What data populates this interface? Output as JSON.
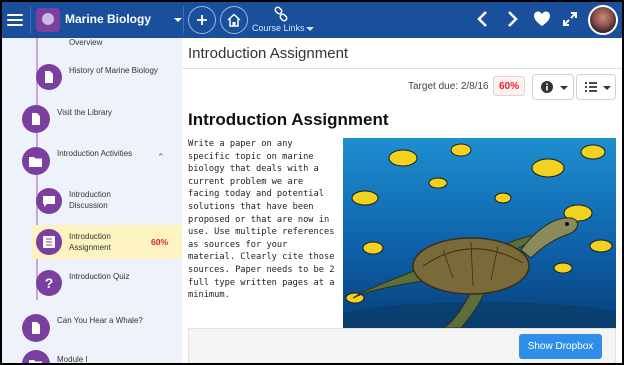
{
  "topbar": {
    "course_title": "Marine Biology",
    "course_links_label": "Course Links"
  },
  "sidebar": {
    "items": [
      {
        "label": "Overview",
        "icon": "document-icon"
      },
      {
        "label": "History of Marine Biology",
        "icon": "document-icon"
      },
      {
        "label": "Visit the Library",
        "icon": "document-icon"
      },
      {
        "label": "Introduction Activities",
        "icon": "folder-icon"
      },
      {
        "label": "Introduction Discussion",
        "icon": "discussion-icon"
      },
      {
        "label": "Introduction Assignment",
        "icon": "assignment-icon",
        "score": "60%",
        "active": true
      },
      {
        "label": "Introduction Quiz",
        "icon": "quiz-icon"
      },
      {
        "label": "Can You Hear a Whale?",
        "icon": "document-icon"
      },
      {
        "label": "Module I",
        "icon": "folder-icon"
      }
    ]
  },
  "content": {
    "header_title": "Introduction Assignment",
    "target_due_label": "Target due: 2/8/16",
    "score_badge": "60%",
    "heading": "Introduction Assignment",
    "body": "Write a paper on any specific topic on marine biology that deals with a current problem we are facing today and potential solutions that have been proposed or that are now in use. Use multiple references as sources for your material. Clearly cite those sources. Paper needs to be 2 full type written pages at a minimum.",
    "dropbox_button": "Show Dropbox"
  },
  "colors": {
    "topbar": "#1a4f9c",
    "purple": "#7b3fa0",
    "active_row": "#fdf3c1",
    "score_red": "#e0222d",
    "dropbox_button": "#2f8fe8"
  }
}
